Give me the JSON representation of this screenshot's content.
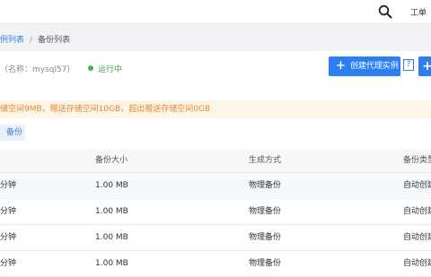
{
  "topbar": {
    "link": "工单"
  },
  "breadcrumb": {
    "parent": "例列表",
    "separator": "/",
    "current": "备份列表"
  },
  "instance": {
    "name": "（名称：mysql57）",
    "status": "运行中"
  },
  "actions": {
    "create_proxy_label": "创建代理实例",
    "help_label": "?",
    "more_label": "+"
  },
  "notice": "储空间9MB，赠送存储空间10GB，超出赠送存储空间0GB",
  "backup_tag": "备份",
  "table": {
    "headers": [
      "",
      "备份大小",
      "生成方式",
      "备份类型"
    ],
    "rows": [
      [
        "分钟",
        "1.00 MB",
        "物理备份",
        "自动创建"
      ],
      [
        "分钟",
        "1.00 MB",
        "物理备份",
        "自动创建"
      ],
      [
        "分钟",
        "1.00 MB",
        "物理备份",
        "自动创建"
      ],
      [
        "分钟",
        "1.00 MB",
        "物理备份",
        "自动创建"
      ]
    ]
  },
  "colors": {
    "accent": "#2d7ef0",
    "link": "#3d7fd9",
    "status": "#3fb24f",
    "notice_bg": "#fdf5e8",
    "notice_text": "#e08a2b"
  },
  "icons": {
    "search": "search-icon"
  }
}
